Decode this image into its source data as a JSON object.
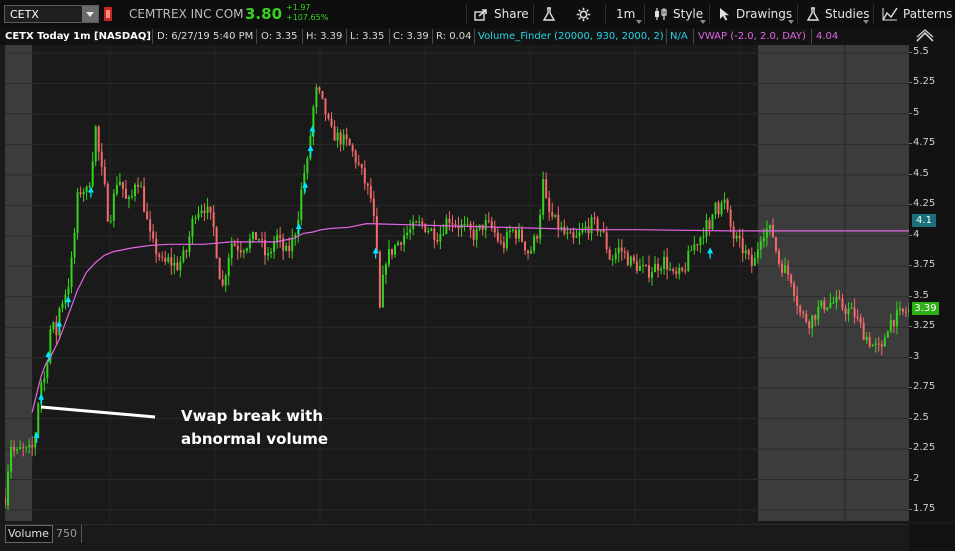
{
  "toolbar": {
    "symbol": "CETX",
    "company": "CEMTREX INC COM",
    "last": "3.80",
    "change_abs": "+1.97",
    "change_pct": "+107.65%",
    "share_label": "Share",
    "timeframe": "1m",
    "style_label": "Style",
    "drawings_label": "Drawings",
    "studies_label": "Studies",
    "patterns_label": "Patterns"
  },
  "infobar": {
    "title": "CETX Today 1m [NASDAQ]",
    "date": "D: 6/27/19 5:40 PM",
    "open": "O: 3.35",
    "high": "H: 3.39",
    "low": "L: 3.35",
    "close": "C: 3.39",
    "range": "R: 0.04",
    "study": "Volume_Finder (20000, 930, 2000, 2)",
    "study_value": "N/A",
    "vwap": "VWAP (-2.0, 2.0, DAY)",
    "vwap_value": "4.04"
  },
  "axis": {
    "ticks": [
      "5.5",
      "5.25",
      "5",
      "4.75",
      "4.5",
      "4.25",
      "4",
      "3.75",
      "3.5",
      "3.25",
      "3",
      "2.75",
      "2.5",
      "2.25",
      "2",
      "1.75"
    ],
    "vwap_badge": "4.1",
    "price_badge": "3.39"
  },
  "annotation": {
    "line1": "Vwap break with",
    "line2": "abnormal volume"
  },
  "volume": {
    "label": "Volume",
    "value": "750"
  },
  "colors": {
    "up": "#35d21e",
    "down": "#f26a6a",
    "vwap": "#e266e2",
    "signal": "#00e5ff",
    "badge_vwap": "#1b6f7a",
    "badge_price": "#2fb014"
  },
  "chart_data": {
    "type": "line",
    "ylim": [
      1.65,
      5.6
    ],
    "session_markers": [
      0.0,
      0.03,
      0.833
    ],
    "close_path": {
      "x": [
        0.0,
        0.006,
        0.012,
        0.018,
        0.025,
        0.03,
        0.034,
        0.038,
        0.042,
        0.045,
        0.048,
        0.052,
        0.056,
        0.06,
        0.065,
        0.07,
        0.075,
        0.08,
        0.085,
        0.09,
        0.095,
        0.1,
        0.105,
        0.11,
        0.115,
        0.12,
        0.125,
        0.13,
        0.135,
        0.14,
        0.145,
        0.15,
        0.155,
        0.16,
        0.165,
        0.17,
        0.175,
        0.18,
        0.19,
        0.2,
        0.21,
        0.22,
        0.23,
        0.24,
        0.25,
        0.26,
        0.27,
        0.28,
        0.29,
        0.3,
        0.31,
        0.315,
        0.32,
        0.325,
        0.33,
        0.335,
        0.34,
        0.345,
        0.35,
        0.355,
        0.36,
        0.37,
        0.38,
        0.39,
        0.395,
        0.4,
        0.405,
        0.41,
        0.415,
        0.42,
        0.43,
        0.44,
        0.45,
        0.46,
        0.47,
        0.48,
        0.49,
        0.5,
        0.51,
        0.52,
        0.53,
        0.54,
        0.55,
        0.56,
        0.57,
        0.58,
        0.59,
        0.595,
        0.6,
        0.61,
        0.62,
        0.63,
        0.64,
        0.65,
        0.66,
        0.67,
        0.68,
        0.69,
        0.7,
        0.71,
        0.72,
        0.73,
        0.74,
        0.75,
        0.76,
        0.77,
        0.775,
        0.78,
        0.785,
        0.79,
        0.795,
        0.8,
        0.805,
        0.81,
        0.815,
        0.82,
        0.825,
        0.83,
        0.835,
        0.84,
        0.845,
        0.85,
        0.855,
        0.86,
        0.865,
        0.87,
        0.875,
        0.88,
        0.89,
        0.9,
        0.91,
        0.92,
        0.93,
        0.94,
        0.95,
        0.96,
        0.97,
        0.975,
        0.98,
        0.99,
        1.0
      ],
      "y": [
        1.85,
        2.3,
        2.2,
        2.25,
        2.22,
        2.25,
        2.4,
        2.75,
        2.85,
        2.8,
        3.15,
        3.3,
        3.15,
        3.4,
        3.5,
        3.6,
        3.85,
        4.3,
        4.4,
        4.35,
        4.5,
        4.9,
        4.6,
        4.4,
        4.1,
        4.3,
        4.5,
        4.4,
        4.25,
        4.3,
        4.5,
        4.4,
        4.2,
        4.0,
        3.9,
        3.85,
        3.75,
        3.8,
        3.75,
        3.85,
        4.2,
        4.25,
        4.1,
        3.55,
        3.95,
        3.9,
        3.95,
        4.0,
        3.8,
        4.0,
        3.85,
        3.9,
        4.0,
        4.2,
        4.5,
        4.6,
        5.0,
        5.2,
        5.1,
        5.0,
        4.85,
        4.8,
        4.75,
        4.6,
        4.5,
        4.4,
        4.3,
        4.0,
        3.35,
        3.8,
        3.9,
        4.0,
        4.05,
        4.1,
        4.05,
        4.0,
        4.15,
        4.1,
        4.05,
        4.0,
        4.1,
        4.05,
        3.9,
        4.05,
        4.0,
        3.85,
        4.05,
        4.45,
        4.2,
        4.1,
        4.0,
        3.95,
        4.05,
        4.1,
        4.05,
        3.8,
        3.9,
        3.8,
        3.75,
        3.7,
        3.75,
        3.8,
        3.65,
        3.7,
        3.9,
        4.0,
        4.1,
        4.0,
        4.35,
        4.2,
        4.3,
        4.15,
        4.0,
        3.95,
        3.9,
        3.85,
        3.75,
        3.8,
        4.0,
        4.05,
        4.05,
        4.0,
        3.8,
        3.75,
        3.7,
        3.65,
        3.5,
        3.35,
        3.3,
        3.4,
        3.45,
        3.45,
        3.4,
        3.35,
        3.2,
        3.1,
        3.05,
        3.25,
        3.3,
        3.35,
        3.39
      ]
    },
    "vwap": {
      "x": [
        0.03,
        0.035,
        0.04,
        0.045,
        0.05,
        0.06,
        0.07,
        0.08,
        0.09,
        0.1,
        0.11,
        0.12,
        0.14,
        0.16,
        0.18,
        0.2,
        0.22,
        0.25,
        0.3,
        0.32,
        0.33,
        0.34,
        0.35,
        0.36,
        0.38,
        0.4,
        0.45,
        0.5,
        0.55,
        0.6,
        0.65,
        0.7,
        0.8,
        0.9,
        1.0
      ],
      "y": [
        2.55,
        2.7,
        2.85,
        2.95,
        3.0,
        3.15,
        3.35,
        3.55,
        3.7,
        3.78,
        3.84,
        3.87,
        3.9,
        3.92,
        3.93,
        3.93,
        3.93,
        3.95,
        3.95,
        3.98,
        4.02,
        4.03,
        4.05,
        4.06,
        4.07,
        4.1,
        4.09,
        4.08,
        4.07,
        4.06,
        4.05,
        4.05,
        4.04,
        4.04,
        4.04
      ]
    },
    "signals_x": [
      0.035,
      0.04,
      0.048,
      0.06,
      0.07,
      0.095,
      0.325,
      0.332,
      0.338,
      0.34,
      0.41,
      0.78
    ]
  }
}
